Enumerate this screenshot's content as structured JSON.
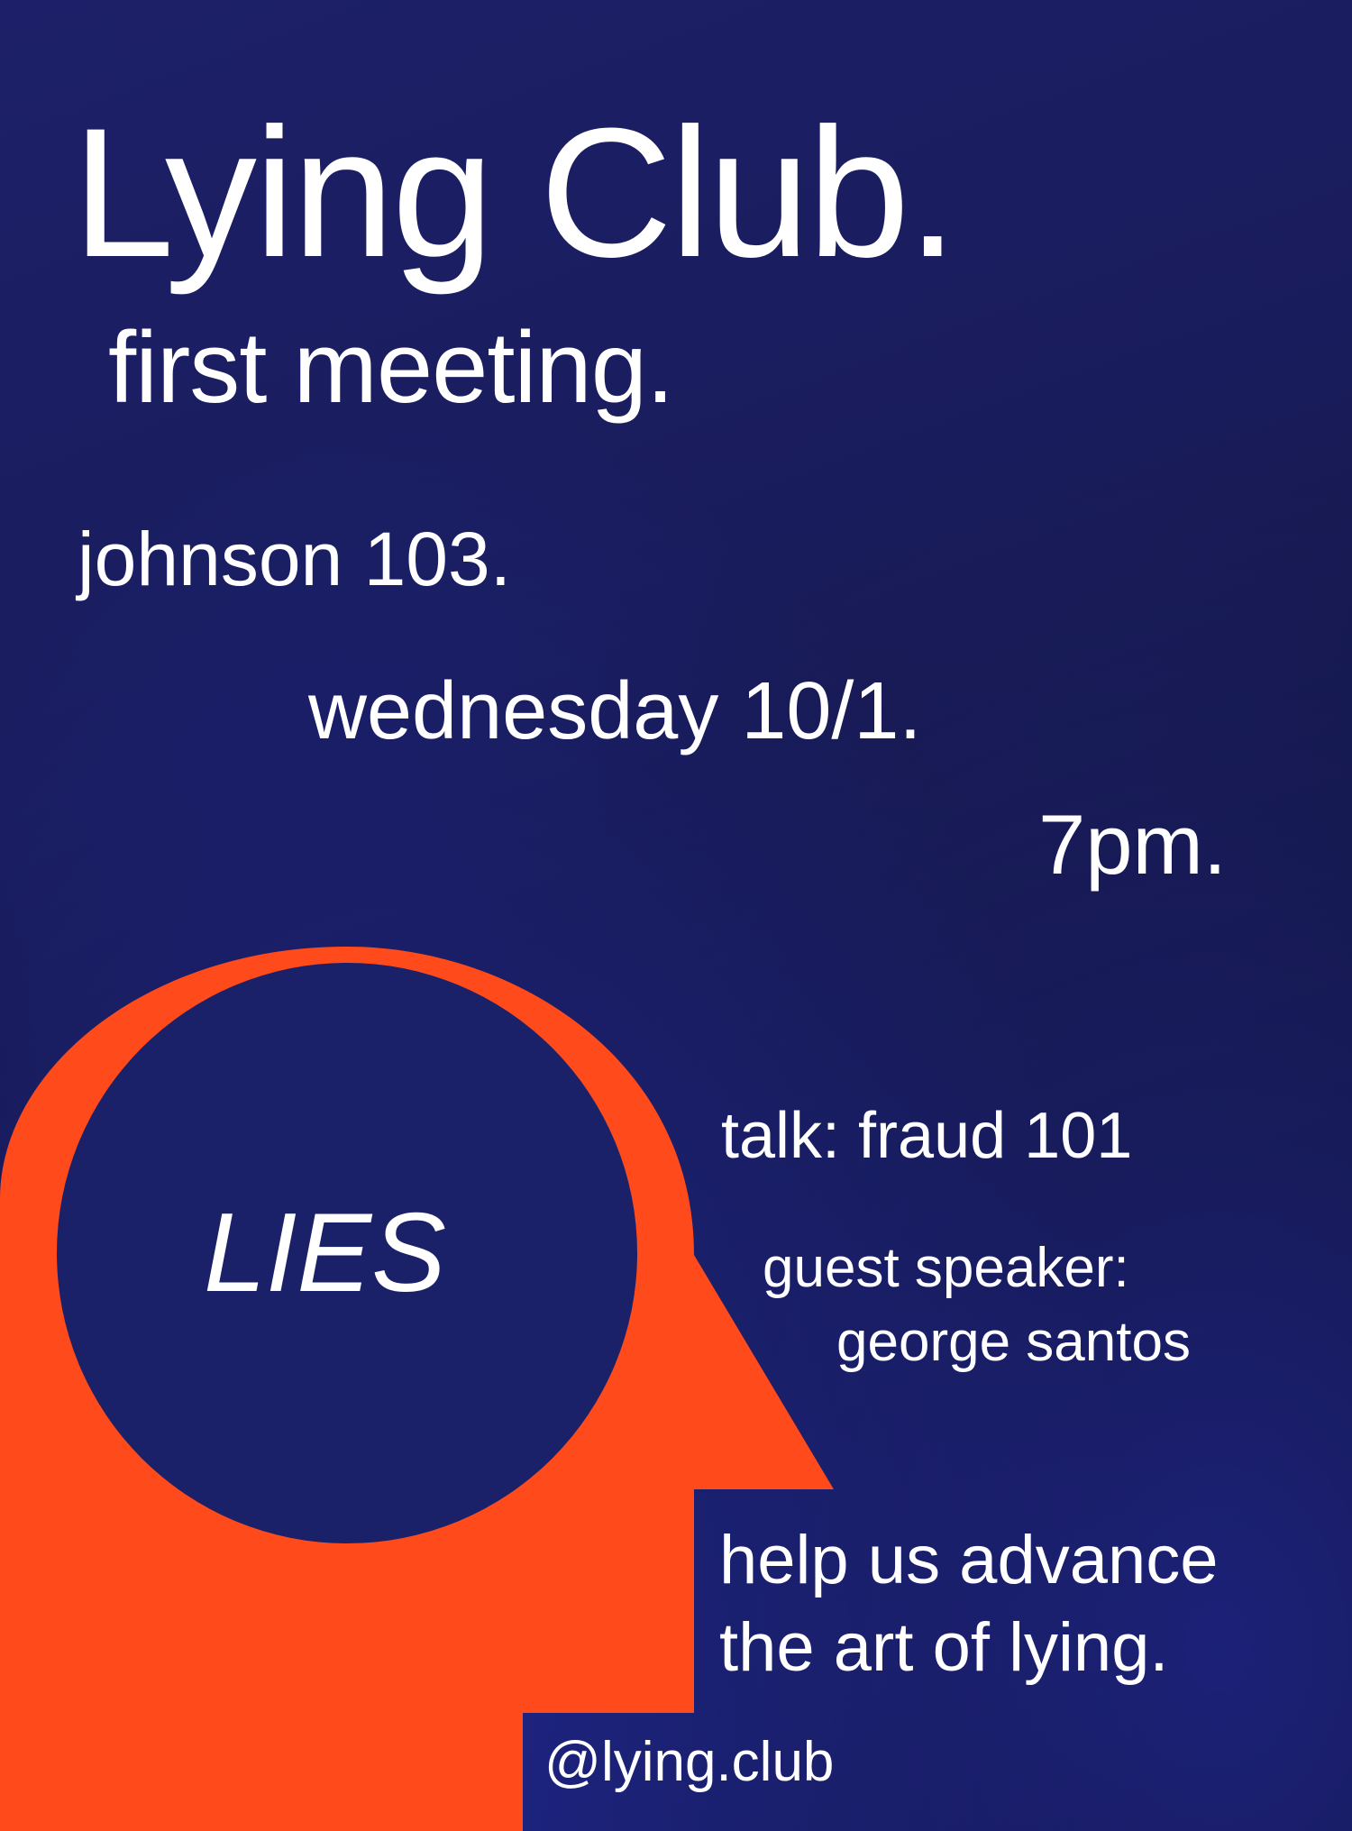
{
  "poster": {
    "title": "Lying Club.",
    "subtitle": "first meeting.",
    "location": "johnson 103.",
    "date": "wednesday 10/1.",
    "time": "7pm.",
    "graphic_text": "LIES",
    "talk": "talk: fraud 101",
    "guest_label": "guest speaker:",
    "guest_name": "george santos",
    "tagline_line1": "help us advance",
    "tagline_line2": "the art of lying.",
    "handle": "@lying.club"
  },
  "colors": {
    "background": "#1b1f66",
    "accent_orange": "#ff4a1c",
    "text": "#ffffff"
  },
  "icons": {
    "head": "head-silhouette-icon"
  }
}
